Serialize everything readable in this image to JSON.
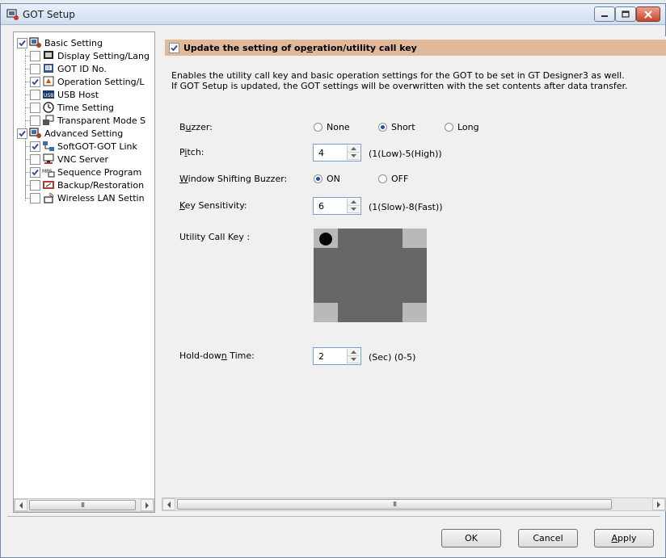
{
  "window": {
    "title": "GOT Setup"
  },
  "tree": {
    "items": [
      {
        "label": "Basic Setting",
        "checked": true,
        "icon": "basic-setting-icon"
      },
      {
        "label": "Display Setting/Lang",
        "checked": false,
        "icon": "display-icon"
      },
      {
        "label": "GOT ID No.",
        "checked": false,
        "icon": "id-icon"
      },
      {
        "label": "Operation Setting/L",
        "checked": true,
        "icon": "operation-icon"
      },
      {
        "label": "USB Host",
        "checked": false,
        "icon": "usb-icon"
      },
      {
        "label": "Time Setting",
        "checked": false,
        "icon": "clock-icon"
      },
      {
        "label": "Transparent Mode S",
        "checked": false,
        "icon": "transparent-mode-icon"
      },
      {
        "label": "Advanced Setting",
        "checked": true,
        "icon": "advanced-setting-icon"
      },
      {
        "label": "SoftGOT-GOT Link",
        "checked": true,
        "icon": "link-icon"
      },
      {
        "label": "VNC Server",
        "checked": false,
        "icon": "vnc-icon"
      },
      {
        "label": "Sequence Program",
        "checked": true,
        "icon": "sequence-icon"
      },
      {
        "label": "Backup/Restoration",
        "checked": false,
        "icon": "backup-icon"
      },
      {
        "label": "Wireless LAN Settin",
        "checked": false,
        "icon": "wireless-icon"
      }
    ],
    "scroll_thumb": "III"
  },
  "main": {
    "section_title_pre": "Update the setting of op",
    "section_title_u": "e",
    "section_title_post": "ration/utility call key",
    "section_checked": true,
    "description_line1": "Enables the utility call key and basic operation settings for the GOT to be set in GT Designer3 as well.",
    "description_line2": "If GOT Setup is updated, the GOT settings will be overwritten with the set contents after data transfer.",
    "buzzer": {
      "label_pre": "B",
      "label_u": "u",
      "label_post": "zzer:",
      "options": [
        "None",
        "Short",
        "Long"
      ],
      "selected": "Short"
    },
    "pitch": {
      "label_pre": "P",
      "label_u": "i",
      "label_post": "tch:",
      "value": "4",
      "hint": "(1(Low)-5(High))"
    },
    "window_shifting_buzzer": {
      "label_pre": "",
      "label_u": "W",
      "label_post": "indow Shifting Buzzer:",
      "options": [
        "ON",
        "OFF"
      ],
      "selected": "ON"
    },
    "key_sensitivity": {
      "label_pre": "",
      "label_u": "K",
      "label_post": "ey Sensitivity:",
      "value": "6",
      "hint": "(1(Slow)-8(Fast))"
    },
    "utility_call_key": {
      "label": "Utility Call Key :"
    },
    "hold_down_time": {
      "label_pre": "Hold-dow",
      "label_u": "n",
      "label_post": " Time:",
      "value": "2",
      "hint": "(Sec) (0-5)"
    },
    "scroll_thumb": "III"
  },
  "buttons": {
    "ok": "OK",
    "cancel": "Cancel",
    "apply_u": "A",
    "apply_post": "pply"
  },
  "colors": {
    "section_bar": "#e0b89a",
    "keypad": "#676767",
    "keypad_corner": "#b9b9b9"
  }
}
